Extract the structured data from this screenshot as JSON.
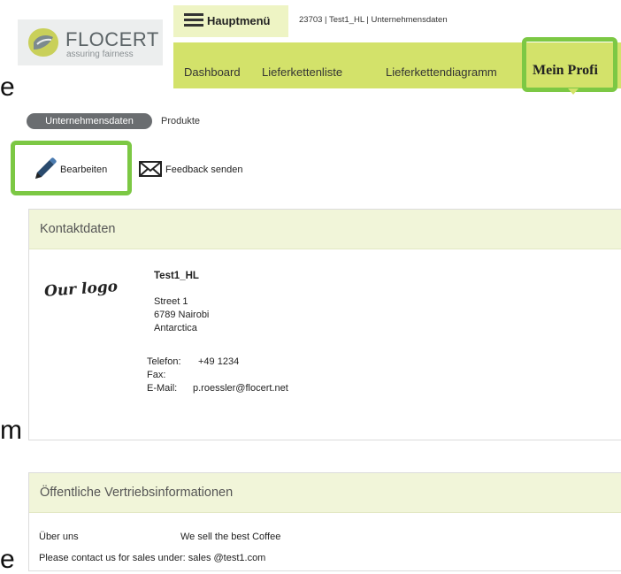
{
  "header": {
    "logo_word": "FLOCERT",
    "logo_tagline": "assuring fairness",
    "menu_label": "Hauptmenü",
    "breadcrumb": "23703 | Test1_HL | Unternehmensdaten"
  },
  "nav": {
    "items": [
      "Dashboard",
      "Lieferkettenliste",
      "Lieferkettendiagramm",
      "Mein Profi"
    ]
  },
  "tabs": {
    "active": "Unternehmensdaten",
    "other": "Produkte"
  },
  "toolbar": {
    "edit_label": "Bearbeiten",
    "feedback_label": "Feedback senden"
  },
  "contact": {
    "title": "Kontaktdaten",
    "logo_text": "Our logo",
    "company": "Test1_HL",
    "street": "Street 1",
    "city": "6789 Nairobi",
    "country": "Antarctica",
    "phone_label": "Telefon:",
    "phone_value": "+49 1234",
    "fax_label": "Fax:",
    "email_label": "E-Mail:",
    "email_value": "p.roessler@flocert.net"
  },
  "public": {
    "title": "Öffentliche Vertriebsinformationen",
    "about_label": "Über uns",
    "about_value": "We sell the best Coffee",
    "contact_line": "Please contact us for sales under: sales @test1.com"
  },
  "stray_letters": [
    "e",
    "m",
    "e"
  ],
  "colors": {
    "nav_bg": "#d3e26a",
    "highlight": "#7cc844",
    "panel_head": "#f1f5d9",
    "pill": "#6a6d70"
  }
}
